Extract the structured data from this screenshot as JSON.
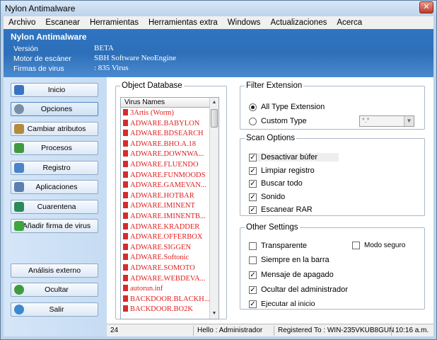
{
  "window": {
    "title": "Nylon Antimalware",
    "close_glyph": "✕"
  },
  "menu": [
    "Archivo",
    "Escanear",
    "Herramientas",
    "Herramientas extra",
    "Windows",
    "Actualizaciones",
    "Acerca"
  ],
  "header": {
    "app_title": "Nylon Antimalware",
    "rows": [
      {
        "label": "Versión",
        "value": "BETA"
      },
      {
        "label": "Motor de escáner",
        "value": "SBH Software NeoEngine"
      },
      {
        "label": "Firmas de virus",
        "value": ": 835 Virus"
      }
    ]
  },
  "sidebar": {
    "items": [
      {
        "label": "Inicio",
        "icon": "home-icon",
        "active": false
      },
      {
        "label": "Opciones",
        "icon": "options-icon",
        "active": true
      },
      {
        "label": "Cambiar atributos",
        "icon": "attributes-icon",
        "active": false
      },
      {
        "label": "Procesos",
        "icon": "processes-icon",
        "active": false
      },
      {
        "label": "Registro",
        "icon": "registry-icon",
        "active": false
      },
      {
        "label": "Aplicaciones",
        "icon": "applications-icon",
        "active": false
      },
      {
        "label": "Cuarentena",
        "icon": "quarantine-icon",
        "active": false
      },
      {
        "label": "Añadir firma de virus",
        "icon": "add-signature-icon",
        "active": false
      }
    ],
    "bottom_items": [
      {
        "label": "Análisis externo",
        "icon": ""
      },
      {
        "label": "Ocultar",
        "icon": "hide-icon"
      },
      {
        "label": "Salir",
        "icon": "exit-icon"
      }
    ]
  },
  "object_database": {
    "legend": "Object Database",
    "column_header": "Virus Names",
    "rows": [
      "3Artis (Worm)",
      "ADWARE.BABYLON",
      "ADWARE.BDSEARCH",
      "ADWARE.BHO.A.18",
      "ADWARE.DOWNWA...",
      "ADWARE.FLUENDO",
      "ADWARE.FUNMOODS",
      "ADWARE.GAMEVAN...",
      "ADWARE.HOTBAR",
      "ADWARE.IMINENT",
      "ADWARE.IMINENTB...",
      "ADWARE.KRADDER",
      "ADWARE.OFFERBOX",
      "ADWARE.SIGGEN",
      "ADWARE.Softonic",
      "ADWARE.SOMOTO",
      "ADWARE.WEBDEVA...",
      "autorun.inf",
      "BACKDOOR.BLACKH...",
      "BACKDOOR.BO2K"
    ]
  },
  "filter_extension": {
    "legend": "Filter Extension",
    "all_type": "All Type Extension",
    "custom_type": "Custom Type",
    "combo_value": "*.*",
    "selected": "all"
  },
  "scan_options": {
    "legend": "Scan Options",
    "items": [
      {
        "label": "Desactivar búfer",
        "checked": true
      },
      {
        "label": "Limpiar registro",
        "checked": true
      },
      {
        "label": "Buscar todo",
        "checked": true
      },
      {
        "label": "Sonido",
        "checked": true
      },
      {
        "label": "Escanear RAR",
        "checked": true
      }
    ]
  },
  "other_settings": {
    "legend": "Other Settings",
    "items": [
      {
        "label": "Transparente",
        "checked": false
      },
      {
        "label": "Modo seguro",
        "checked": false
      },
      {
        "label": "Siempre en la barra",
        "checked": false
      },
      {
        "label": "Mensaje de apagado",
        "checked": true
      },
      {
        "label": "Ocultar del administrador",
        "checked": true
      },
      {
        "label": "Ejecutar al inicio",
        "checked": true
      }
    ]
  },
  "statusbar": {
    "count": "24",
    "user": "Hello : Administrador",
    "registered": "Registered To : WIN-235VKUB8GUN",
    "time": "10:16 a.m."
  },
  "colors": {
    "header_blue": "#2d6fb8",
    "virus_red": "#e02020",
    "sidebar_bg": "#c6dcf3"
  }
}
